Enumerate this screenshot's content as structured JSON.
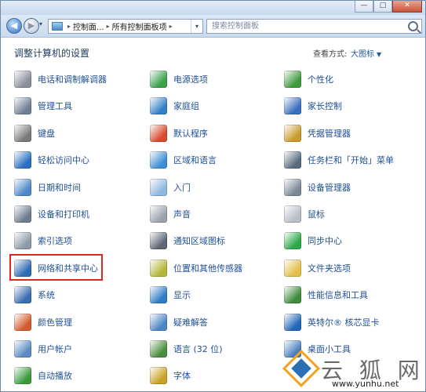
{
  "window": {
    "buttons": {
      "minimize": "—",
      "maximize": "□",
      "close": "✕"
    }
  },
  "nav": {
    "back_glyph": "◀",
    "forward_glyph": "▶",
    "dropdown_glyph": "▾",
    "breadcrumb": [
      "控制面...",
      "所有控制面板项"
    ],
    "refresh_glyph": "↻",
    "search_placeholder": "搜索控制面板"
  },
  "header": {
    "title": "调整计算机的设置",
    "view_by_label": "查看方式:",
    "view_by_value": "大图标"
  },
  "columns": [
    [
      {
        "label": "电话和调制解调器",
        "icon": "phone-modem-icon",
        "color": "#8a8f99"
      },
      {
        "label": "管理工具",
        "icon": "admin-tools-icon",
        "color": "#6f7f93"
      },
      {
        "label": "键盘",
        "icon": "keyboard-icon",
        "color": "#7a7a7a"
      },
      {
        "label": "轻松访问中心",
        "icon": "ease-of-access-icon",
        "color": "#2a6fc2"
      },
      {
        "label": "日期和时间",
        "icon": "date-time-icon",
        "color": "#4e88c9"
      },
      {
        "label": "设备和打印机",
        "icon": "devices-printers-icon",
        "color": "#6e7c8f"
      },
      {
        "label": "索引选项",
        "icon": "indexing-options-icon",
        "color": "#8e9aa8"
      },
      {
        "label": "网络和共享中心",
        "icon": "network-sharing-icon",
        "color": "#2e6bb5"
      },
      {
        "label": "系统",
        "icon": "system-icon",
        "color": "#3a6db0"
      },
      {
        "label": "颜色管理",
        "icon": "color-management-icon",
        "color": "#d25c2f"
      },
      {
        "label": "用户帐户",
        "icon": "user-accounts-icon",
        "color": "#5b8bc2"
      },
      {
        "label": "自动播放",
        "icon": "autoplay-icon",
        "color": "#3c9a3c"
      }
    ],
    [
      {
        "label": "电源选项",
        "icon": "power-options-icon",
        "color": "#3aa04a"
      },
      {
        "label": "家庭组",
        "icon": "homegroup-icon",
        "color": "#3580c8"
      },
      {
        "label": "默认程序",
        "icon": "default-programs-icon",
        "color": "#d84a2a"
      },
      {
        "label": "区域和语言",
        "icon": "region-language-icon",
        "color": "#3e8fd6"
      },
      {
        "label": "入门",
        "icon": "getting-started-icon",
        "color": "#8fb8de"
      },
      {
        "label": "声音",
        "icon": "sound-icon",
        "color": "#9aa3ad"
      },
      {
        "label": "通知区域图标",
        "icon": "notification-area-icon",
        "color": "#5c6675"
      },
      {
        "label": "位置和其他传感器",
        "icon": "location-sensors-icon",
        "color": "#b4b83a"
      },
      {
        "label": "显示",
        "icon": "display-icon",
        "color": "#2f7cc4"
      },
      {
        "label": "疑难解答",
        "icon": "troubleshooting-icon",
        "color": "#4d86c4"
      },
      {
        "label": "语言 (32 位)",
        "icon": "language-32bit-icon",
        "color": "#4a8e3c"
      },
      {
        "label": "字体",
        "icon": "fonts-icon",
        "color": "#c9a227"
      }
    ],
    [
      {
        "label": "个性化",
        "icon": "personalization-icon",
        "color": "#3f9a3f"
      },
      {
        "label": "家长控制",
        "icon": "parental-controls-icon",
        "color": "#3a6fc0"
      },
      {
        "label": "凭据管理器",
        "icon": "credential-manager-icon",
        "color": "#c99a2e"
      },
      {
        "label": "任务栏和「开始」菜单",
        "icon": "taskbar-start-menu-icon",
        "color": "#5a6b80"
      },
      {
        "label": "设备管理器",
        "icon": "device-manager-icon",
        "color": "#7d8896"
      },
      {
        "label": "鼠标",
        "icon": "mouse-icon",
        "color": "#b9bec6"
      },
      {
        "label": "同步中心",
        "icon": "sync-center-icon",
        "color": "#2fa84a"
      },
      {
        "label": "文件夹选项",
        "icon": "folder-options-icon",
        "color": "#e3c04a"
      },
      {
        "label": "性能信息和工具",
        "icon": "performance-tools-icon",
        "color": "#3e8a3e"
      },
      {
        "label": "英特尔® 核芯显卡",
        "icon": "intel-graphics-icon",
        "color": "#2467b8"
      },
      {
        "label": "桌面小工具",
        "icon": "desktop-gadgets-icon",
        "color": "#4a7fbd"
      },
      {
        "label": "",
        "icon": "",
        "color": ""
      }
    ]
  ],
  "watermark": {
    "text": "云 狐 网",
    "url": "www.yunhu.net"
  }
}
